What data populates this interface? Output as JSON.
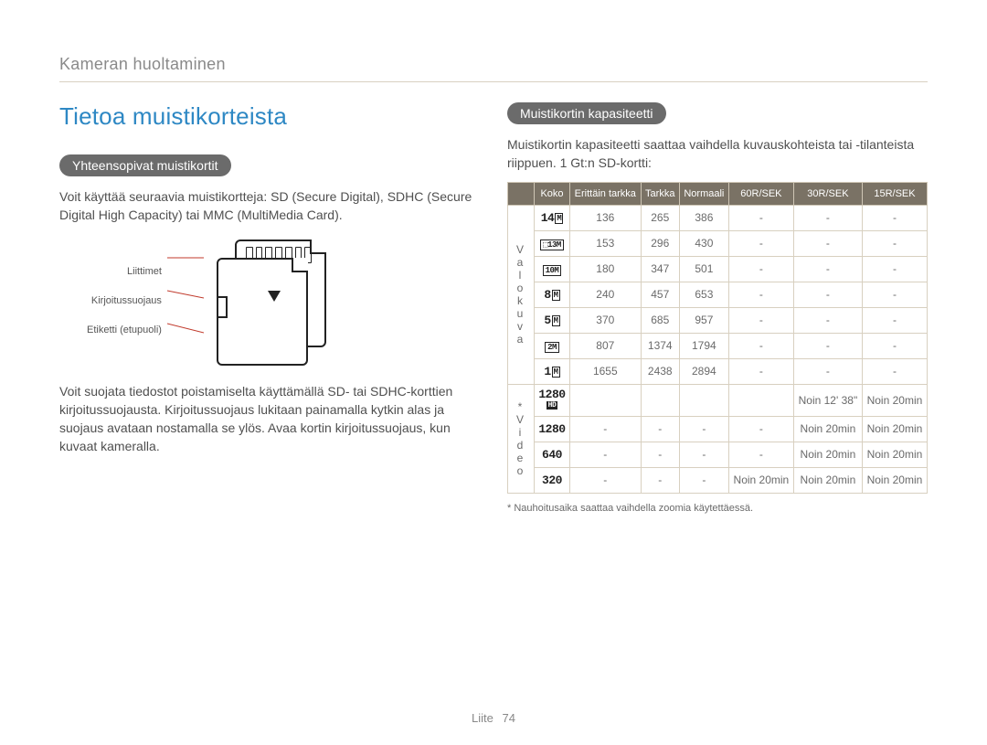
{
  "breadcrumb": "Kameran huoltaminen",
  "title": "Tietoa muistikorteista",
  "left": {
    "pill": "Yhteensopivat muistikortit",
    "intro": "Voit käyttää seuraavia muistikortteja: SD (Secure Digital), SDHC (Secure Digital High Capacity) tai MMC (MultiMedia Card).",
    "labels": {
      "a": "Liittimet",
      "b": "Kirjoitussuojaus",
      "c": "Etiketti (etupuoli)"
    },
    "lock_text": "Voit suojata tiedostot poistamiselta käyttämällä SD- tai SDHC-korttien kirjoitussuojausta. Kirjoitussuojaus lukitaan painamalla kytkin alas ja suojaus avataan nostamalla se ylös. Avaa kortin kirjoitussuojaus, kun kuvaat kameralla."
  },
  "right": {
    "pill": "Muistikortin kapasiteetti",
    "intro": "Muistikortin kapasiteetti saattaa vaihdella kuvauskohteista tai -tilanteista riippuen. 1 Gt:n SD-kortti:",
    "headers": [
      "Koko",
      "Erittäin tarkka",
      "Tarkka",
      "Normaali",
      "60R/SEK",
      "30R/SEK",
      "15R/SEK"
    ],
    "cat_photo": "Valokuva",
    "cat_video_star": "*",
    "cat_video": "Video",
    "rows_photo": [
      {
        "icon": "14m",
        "v": [
          "136",
          "265",
          "386",
          "-",
          "-",
          "-"
        ]
      },
      {
        "icon": "13box",
        "v": [
          "153",
          "296",
          "430",
          "-",
          "-",
          "-"
        ]
      },
      {
        "icon": "10box",
        "v": [
          "180",
          "347",
          "501",
          "-",
          "-",
          "-"
        ]
      },
      {
        "icon": "8m",
        "v": [
          "240",
          "457",
          "653",
          "-",
          "-",
          "-"
        ]
      },
      {
        "icon": "5m",
        "v": [
          "370",
          "685",
          "957",
          "-",
          "-",
          "-"
        ]
      },
      {
        "icon": "2box",
        "v": [
          "807",
          "1374",
          "1794",
          "-",
          "-",
          "-"
        ]
      },
      {
        "icon": "1m",
        "v": [
          "1655",
          "2438",
          "2894",
          "-",
          "-",
          "-"
        ]
      }
    ],
    "rows_video": [
      {
        "icon": "1280hd",
        "v": [
          "",
          "",
          "",
          "",
          "Noin 12' 38\"",
          "Noin 20min"
        ]
      },
      {
        "icon": "1280",
        "v": [
          "-",
          "-",
          "-",
          "-",
          "Noin 20min",
          "Noin 20min"
        ]
      },
      {
        "icon": "640",
        "v": [
          "-",
          "-",
          "-",
          "-",
          "Noin 20min",
          "Noin 20min"
        ]
      },
      {
        "icon": "320",
        "v": [
          "-",
          "-",
          "-",
          "Noin 20min",
          "Noin 20min",
          "Noin 20min"
        ]
      }
    ],
    "footnote": "* Nauhoitusaika saattaa vaihdella zoomia käytettäessä."
  },
  "footer": {
    "section": "Liite",
    "page": "74"
  }
}
